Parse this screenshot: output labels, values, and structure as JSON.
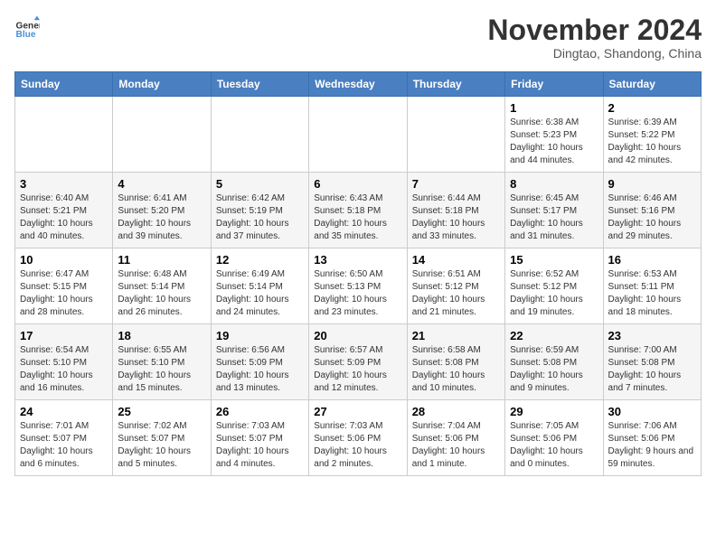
{
  "header": {
    "logo_line1": "General",
    "logo_line2": "Blue",
    "month": "November 2024",
    "location": "Dingtao, Shandong, China"
  },
  "days_of_week": [
    "Sunday",
    "Monday",
    "Tuesday",
    "Wednesday",
    "Thursday",
    "Friday",
    "Saturday"
  ],
  "weeks": [
    [
      null,
      null,
      null,
      null,
      null,
      {
        "day": "1",
        "sunrise": "6:38 AM",
        "sunset": "5:23 PM",
        "daylight": "10 hours and 44 minutes."
      },
      {
        "day": "2",
        "sunrise": "6:39 AM",
        "sunset": "5:22 PM",
        "daylight": "10 hours and 42 minutes."
      }
    ],
    [
      {
        "day": "3",
        "sunrise": "6:40 AM",
        "sunset": "5:21 PM",
        "daylight": "10 hours and 40 minutes."
      },
      {
        "day": "4",
        "sunrise": "6:41 AM",
        "sunset": "5:20 PM",
        "daylight": "10 hours and 39 minutes."
      },
      {
        "day": "5",
        "sunrise": "6:42 AM",
        "sunset": "5:19 PM",
        "daylight": "10 hours and 37 minutes."
      },
      {
        "day": "6",
        "sunrise": "6:43 AM",
        "sunset": "5:18 PM",
        "daylight": "10 hours and 35 minutes."
      },
      {
        "day": "7",
        "sunrise": "6:44 AM",
        "sunset": "5:18 PM",
        "daylight": "10 hours and 33 minutes."
      },
      {
        "day": "8",
        "sunrise": "6:45 AM",
        "sunset": "5:17 PM",
        "daylight": "10 hours and 31 minutes."
      },
      {
        "day": "9",
        "sunrise": "6:46 AM",
        "sunset": "5:16 PM",
        "daylight": "10 hours and 29 minutes."
      }
    ],
    [
      {
        "day": "10",
        "sunrise": "6:47 AM",
        "sunset": "5:15 PM",
        "daylight": "10 hours and 28 minutes."
      },
      {
        "day": "11",
        "sunrise": "6:48 AM",
        "sunset": "5:14 PM",
        "daylight": "10 hours and 26 minutes."
      },
      {
        "day": "12",
        "sunrise": "6:49 AM",
        "sunset": "5:14 PM",
        "daylight": "10 hours and 24 minutes."
      },
      {
        "day": "13",
        "sunrise": "6:50 AM",
        "sunset": "5:13 PM",
        "daylight": "10 hours and 23 minutes."
      },
      {
        "day": "14",
        "sunrise": "6:51 AM",
        "sunset": "5:12 PM",
        "daylight": "10 hours and 21 minutes."
      },
      {
        "day": "15",
        "sunrise": "6:52 AM",
        "sunset": "5:12 PM",
        "daylight": "10 hours and 19 minutes."
      },
      {
        "day": "16",
        "sunrise": "6:53 AM",
        "sunset": "5:11 PM",
        "daylight": "10 hours and 18 minutes."
      }
    ],
    [
      {
        "day": "17",
        "sunrise": "6:54 AM",
        "sunset": "5:10 PM",
        "daylight": "10 hours and 16 minutes."
      },
      {
        "day": "18",
        "sunrise": "6:55 AM",
        "sunset": "5:10 PM",
        "daylight": "10 hours and 15 minutes."
      },
      {
        "day": "19",
        "sunrise": "6:56 AM",
        "sunset": "5:09 PM",
        "daylight": "10 hours and 13 minutes."
      },
      {
        "day": "20",
        "sunrise": "6:57 AM",
        "sunset": "5:09 PM",
        "daylight": "10 hours and 12 minutes."
      },
      {
        "day": "21",
        "sunrise": "6:58 AM",
        "sunset": "5:08 PM",
        "daylight": "10 hours and 10 minutes."
      },
      {
        "day": "22",
        "sunrise": "6:59 AM",
        "sunset": "5:08 PM",
        "daylight": "10 hours and 9 minutes."
      },
      {
        "day": "23",
        "sunrise": "7:00 AM",
        "sunset": "5:08 PM",
        "daylight": "10 hours and 7 minutes."
      }
    ],
    [
      {
        "day": "24",
        "sunrise": "7:01 AM",
        "sunset": "5:07 PM",
        "daylight": "10 hours and 6 minutes."
      },
      {
        "day": "25",
        "sunrise": "7:02 AM",
        "sunset": "5:07 PM",
        "daylight": "10 hours and 5 minutes."
      },
      {
        "day": "26",
        "sunrise": "7:03 AM",
        "sunset": "5:07 PM",
        "daylight": "10 hours and 4 minutes."
      },
      {
        "day": "27",
        "sunrise": "7:03 AM",
        "sunset": "5:06 PM",
        "daylight": "10 hours and 2 minutes."
      },
      {
        "day": "28",
        "sunrise": "7:04 AM",
        "sunset": "5:06 PM",
        "daylight": "10 hours and 1 minute."
      },
      {
        "day": "29",
        "sunrise": "7:05 AM",
        "sunset": "5:06 PM",
        "daylight": "10 hours and 0 minutes."
      },
      {
        "day": "30",
        "sunrise": "7:06 AM",
        "sunset": "5:06 PM",
        "daylight": "9 hours and 59 minutes."
      }
    ]
  ]
}
